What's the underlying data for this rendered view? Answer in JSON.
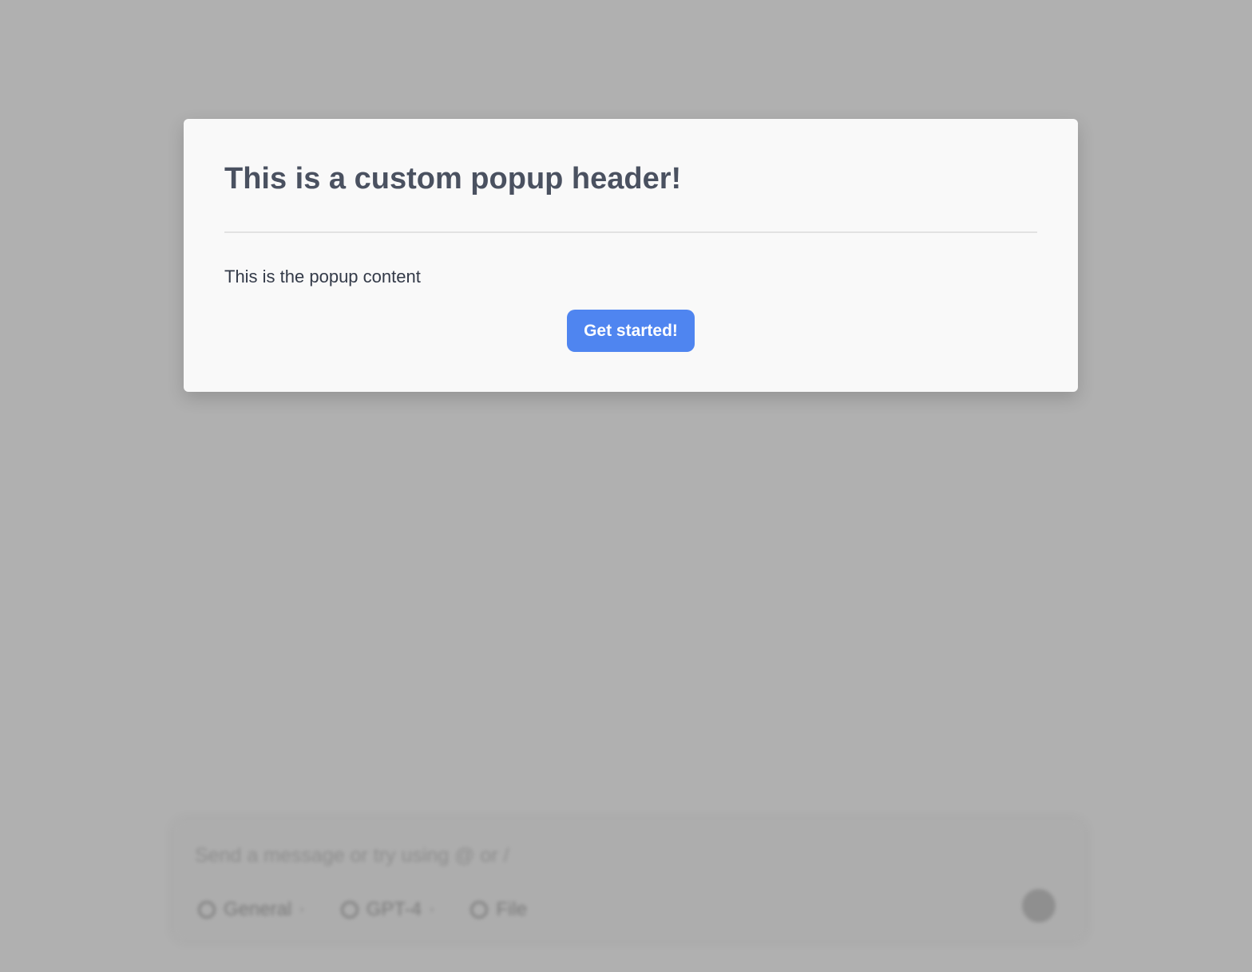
{
  "popup": {
    "header": "This is a custom popup header!",
    "content": "This is the popup content",
    "cta_label": "Get started!"
  },
  "composer": {
    "placeholder": "Send a message or try using @ or /",
    "toolbar": [
      {
        "label": "General",
        "icon": "person-icon"
      },
      {
        "label": "GPT-4",
        "icon": "model-icon"
      },
      {
        "label": "File",
        "icon": "attach-icon"
      }
    ]
  },
  "colors": {
    "overlay": "#b0b0b0",
    "popup_bg": "#f9f9f9",
    "title": "#4a5160",
    "cta_bg": "#4f85f0"
  }
}
